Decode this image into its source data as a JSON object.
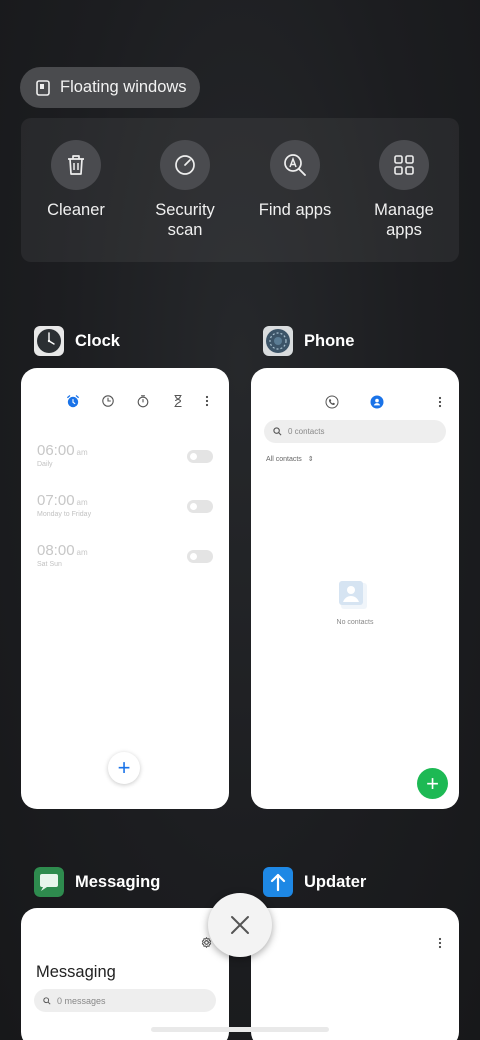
{
  "floating_windows": {
    "label": "Floating windows",
    "icon": "floating-window-icon"
  },
  "tools": [
    {
      "label": "Cleaner",
      "icon": "trash-icon"
    },
    {
      "label": "Security\nscan",
      "icon": "security-scan-icon"
    },
    {
      "label": "Find apps",
      "icon": "find-apps-icon"
    },
    {
      "label": "Manage\napps",
      "icon": "grid-icon"
    }
  ],
  "apps": {
    "clock": {
      "name": "Clock",
      "alarms": [
        {
          "time": "06:00",
          "ampm": "am",
          "days": "Daily"
        },
        {
          "time": "07:00",
          "ampm": "am",
          "days": "Monday to Friday"
        },
        {
          "time": "08:00",
          "ampm": "am",
          "days": "Sat Sun"
        }
      ],
      "fab": "+",
      "accent": "#1a73e8"
    },
    "phone": {
      "name": "Phone",
      "search_placeholder": "0 contacts",
      "filter": "All contacts",
      "empty": "No contacts",
      "fab": "+",
      "accent": "#1db954"
    },
    "messaging": {
      "name": "Messaging",
      "title": "Messaging",
      "search_placeholder": "0 messages"
    },
    "updater": {
      "name": "Updater"
    }
  }
}
